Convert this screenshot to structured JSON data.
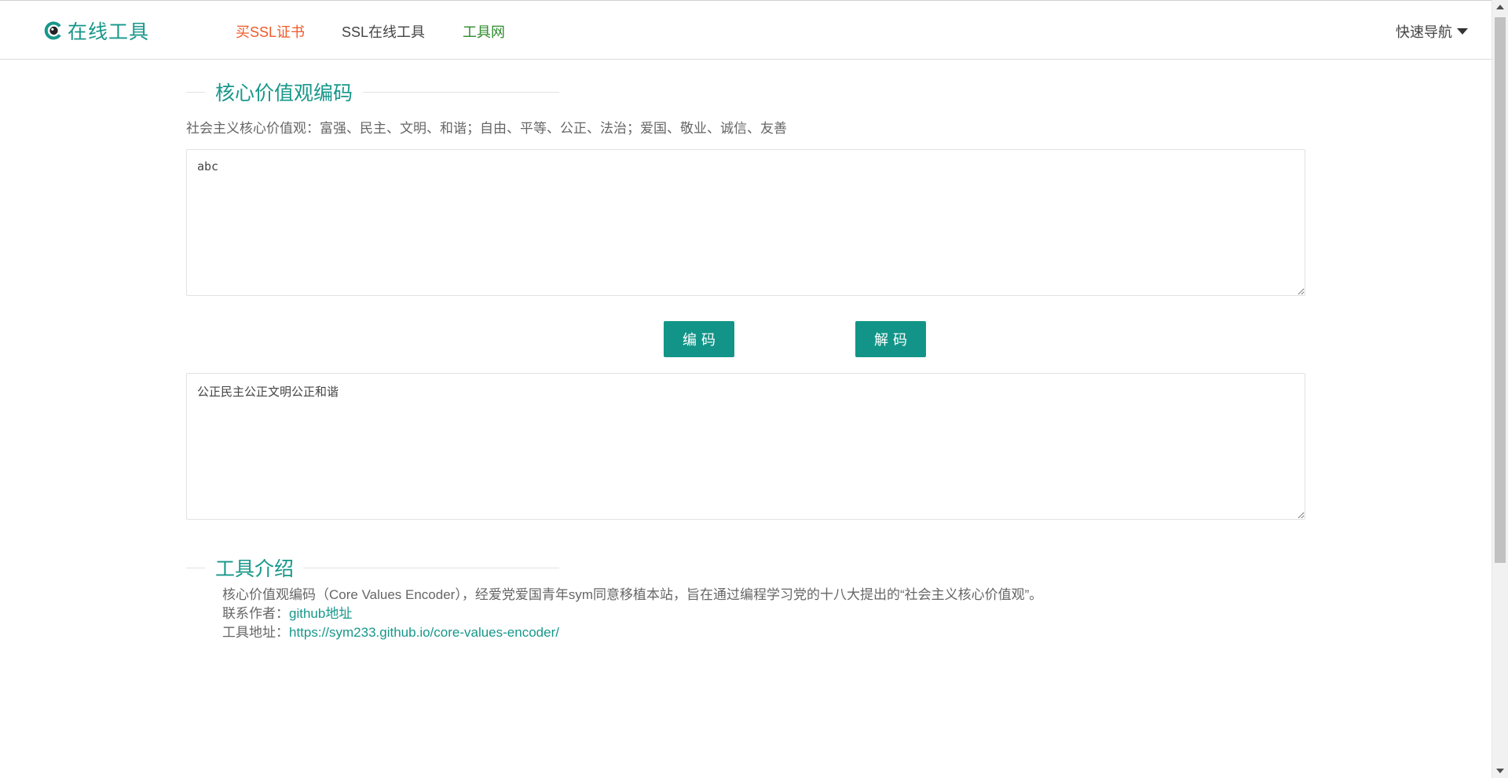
{
  "header": {
    "logo_text": "在线工具",
    "nav": [
      {
        "label": "买SSL证书",
        "color": "#f05a28"
      },
      {
        "label": "SSL在线工具",
        "color": "#444444"
      },
      {
        "label": "工具网",
        "color": "#2e8b2e"
      }
    ],
    "quick_nav_label": "快速导航"
  },
  "encoder": {
    "title": "核心价值观编码",
    "subtitle": "社会主义核心价值观：富强、民主、文明、和谐；自由、平等、公正、法治；爱国、敬业、诚信、友善",
    "input_value": "abc",
    "output_value": "公正民主公正文明公正和谐",
    "encode_label": "编码",
    "decode_label": "解码"
  },
  "intro": {
    "title": "工具介绍",
    "description": "核心价值观编码（Core Values Encoder），经爱党爱国青年sym同意移植本站，旨在通过编程学习党的十八大提出的“社会主义核心价值观”。",
    "author_label": "联系作者：",
    "author_link": "github地址",
    "url_label": "工具地址：",
    "url_link": "https://sym233.github.io/core-values-encoder/"
  },
  "colors": {
    "accent": "#17978a",
    "button": "#129588",
    "buy_link": "#f05a28",
    "tool_link": "#2e8b2e"
  },
  "icons": {
    "logo": "logo-eye-icon",
    "quick_nav": "caret-down-icon"
  }
}
